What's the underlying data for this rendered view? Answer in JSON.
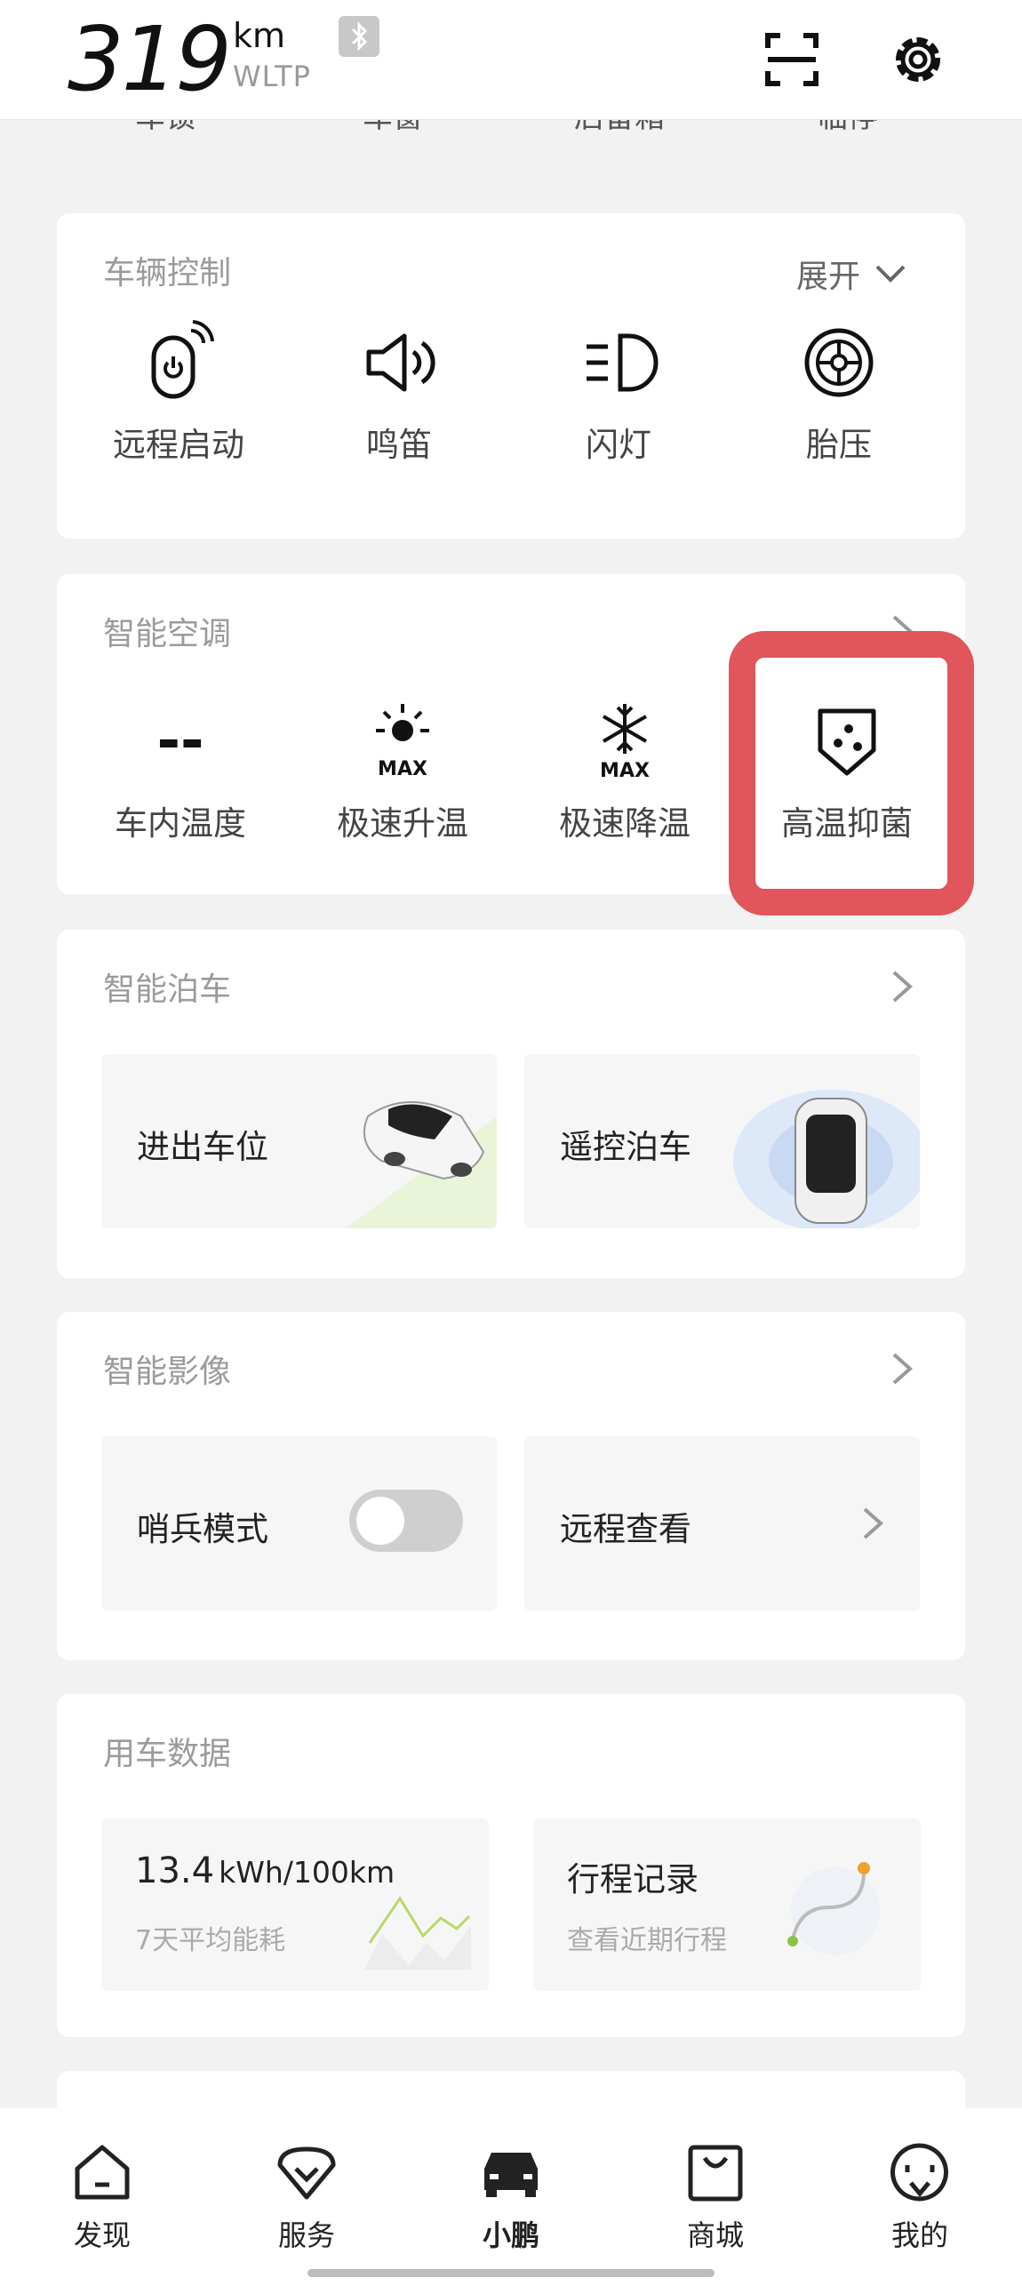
{
  "header": {
    "range_value": "319",
    "range_unit": "km",
    "range_standard": "WLTP"
  },
  "top_strip": [
    "车锁",
    "车窗",
    "后备箱",
    "临停"
  ],
  "vehicle_control": {
    "title": "车辆控制",
    "expand_label": "展开",
    "items": [
      {
        "label": "远程启动",
        "icon": "remote-start-icon"
      },
      {
        "label": "鸣笛",
        "icon": "horn-icon"
      },
      {
        "label": "闪灯",
        "icon": "headlight-icon"
      },
      {
        "label": "胎压",
        "icon": "tire-icon"
      }
    ]
  },
  "climate": {
    "title": "智能空调",
    "items": [
      {
        "label": "车内温度",
        "value": "--"
      },
      {
        "label": "极速升温",
        "icon": "sun-max-icon",
        "badge": "MAX"
      },
      {
        "label": "极速降温",
        "icon": "snowflake-max-icon",
        "badge": "MAX"
      },
      {
        "label": "高温抑菌",
        "icon": "shield-sterilize-icon"
      }
    ],
    "highlight_color": "#e0565b"
  },
  "parking": {
    "title": "智能泊车",
    "tiles": [
      {
        "label": "进出车位"
      },
      {
        "label": "遥控泊车"
      }
    ]
  },
  "imaging": {
    "title": "智能影像",
    "sentry_label": "哨兵模式",
    "sentry_enabled": false,
    "remote_view_label": "远程查看"
  },
  "usage": {
    "title": "用车数据",
    "energy_value": "13.4",
    "energy_unit": "kWh/100km",
    "energy_sub": "7天平均能耗",
    "trip_title": "行程记录",
    "trip_sub": "查看近期行程"
  },
  "tabs": [
    {
      "label": "发现",
      "icon": "home-icon",
      "active": false
    },
    {
      "label": "服务",
      "icon": "service-icon",
      "active": false
    },
    {
      "label": "小鹏",
      "icon": "car-icon",
      "active": true
    },
    {
      "label": "商城",
      "icon": "shop-icon",
      "active": false
    },
    {
      "label": "我的",
      "icon": "profile-icon",
      "active": false
    }
  ],
  "colors": {
    "accent_red": "#e0565b",
    "toggle_off": "#cfcfcf",
    "chart_green": "#b8d86a",
    "route_orange": "#f0a030"
  }
}
